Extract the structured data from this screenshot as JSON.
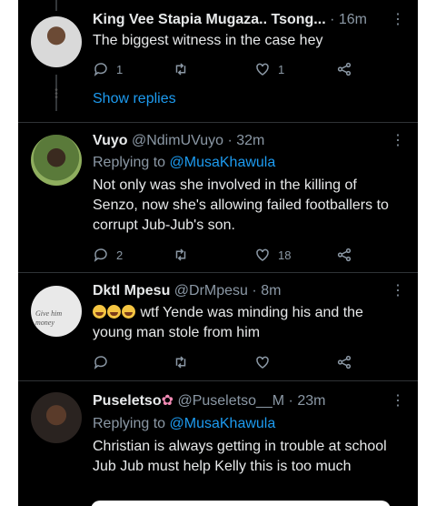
{
  "tweets": [
    {
      "name": "King Vee Stapia Mugaza.. Tsong...",
      "time": "16m",
      "text": "The biggest witness in the case hey",
      "reply_count": "1",
      "like_count": "1",
      "show_replies": "Show replies"
    },
    {
      "name": "Vuyo",
      "handle": "@NdimUVuyo",
      "time": "32m",
      "replying_to": "Replying to",
      "mention": "@MusaKhawula",
      "text": "Not only was she involved in the killing of Senzo, now she's allowing failed footballers to corrupt Jub-Jub's son.",
      "reply_count": "2",
      "like_count": "18"
    },
    {
      "name": "Dktl Mpesu",
      "handle": "@DrMpesu",
      "time": "8m",
      "text": "wtf Yende was minding his and the young man stole from him",
      "avatar_sign": "Give him money"
    },
    {
      "name": "Puseletso",
      "handle": "@Puseletso__M",
      "time": "23m",
      "replying_to": "Replying to",
      "mention": "@MusaKhawula",
      "text": "Christian is always getting in trouble at school Jub Jub must help Kelly this is too much"
    }
  ],
  "separator": "·",
  "more_icon": "⋮",
  "colors": {
    "background": "#000000",
    "accent": "#1d9bf0",
    "secondary": "#8b98a5"
  }
}
